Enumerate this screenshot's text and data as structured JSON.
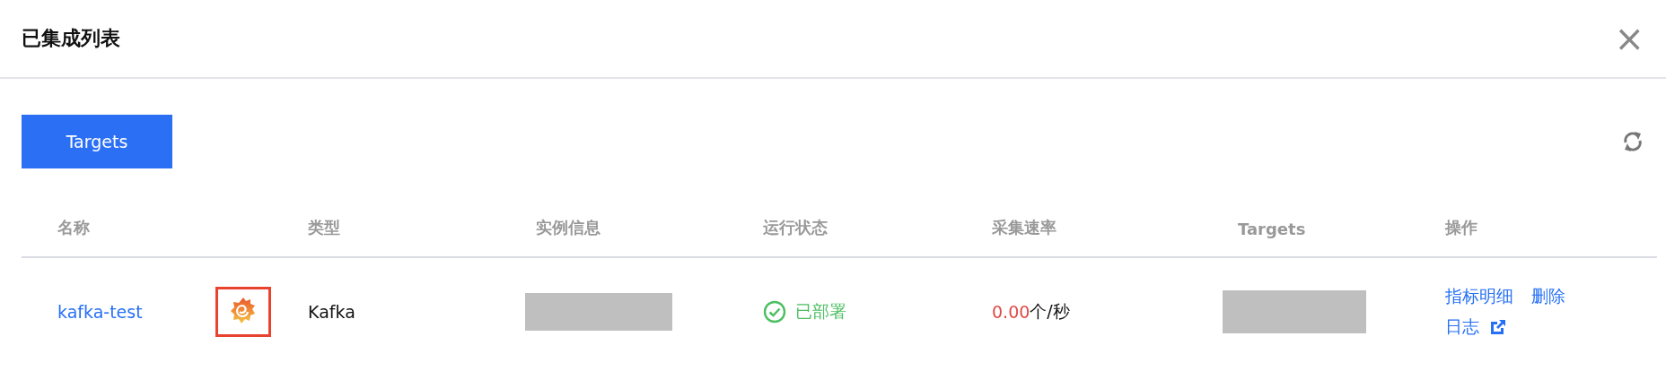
{
  "dialog": {
    "title": "已集成列表",
    "close": "×"
  },
  "toolbar": {
    "button": "Targets"
  },
  "table": {
    "columns": [
      "名称",
      "类型",
      "实例信息",
      "运行状态",
      "采集速率",
      "Targets",
      "操作"
    ],
    "rows": [
      {
        "name": "kafka-test",
        "type": "Kafka",
        "status": {
          "kind": "deployed",
          "text": "已部署"
        },
        "rate_value": "0.00",
        "rate_unit": "个/秒",
        "actions": [
          "指标明细",
          "删除"
        ],
        "log_link": "日志"
      }
    ]
  }
}
